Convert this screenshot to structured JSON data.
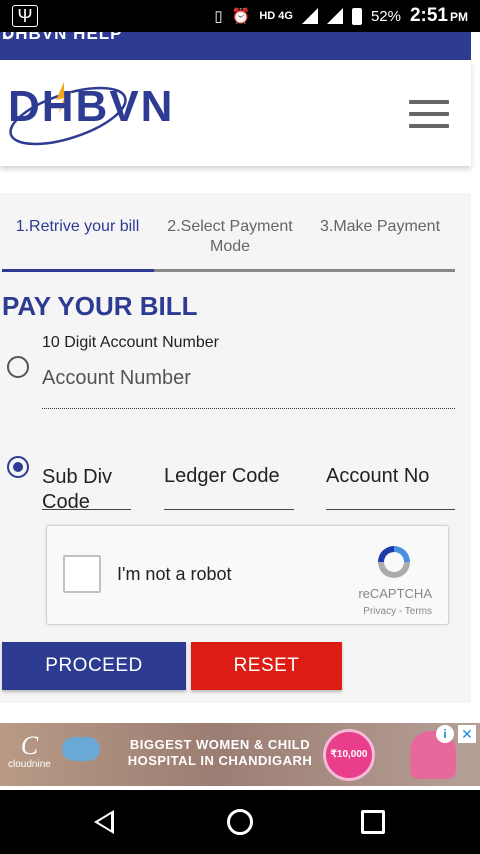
{
  "status_bar": {
    "battery": "52%",
    "time": "2:51",
    "ampm": "PM",
    "network": "HD 4G"
  },
  "top_strip": {
    "text": "DHBVN HELP"
  },
  "header": {
    "logo_text": "DHBVN",
    "brand_color": "#2e3b92"
  },
  "steps": [
    {
      "label": "1.Retrive your bill"
    },
    {
      "label": "2.Select Payment Mode"
    },
    {
      "label": "3.Make Payment"
    }
  ],
  "form": {
    "title": "PAY YOUR BILL",
    "option1_caption": "10 Digit Account Number",
    "account_number_placeholder": "Account Number",
    "subdiv_label": "Sub Div Code",
    "ledger_label": "Ledger Code",
    "account_no_label": "Account No"
  },
  "captcha": {
    "label": "I'm not a robot",
    "brand": "reCAPTCHA",
    "links": "Privacy - Terms"
  },
  "buttons": {
    "proceed": "PROCEED",
    "reset": "RESET",
    "proceed_color": "#2e3b92",
    "reset_color": "#dd1c13"
  },
  "ad": {
    "brand": "cloudnine",
    "headline": "BIGGEST WOMEN & CHILD HOSPITAL IN CHANDIGARH",
    "badge": "₹10,000"
  }
}
